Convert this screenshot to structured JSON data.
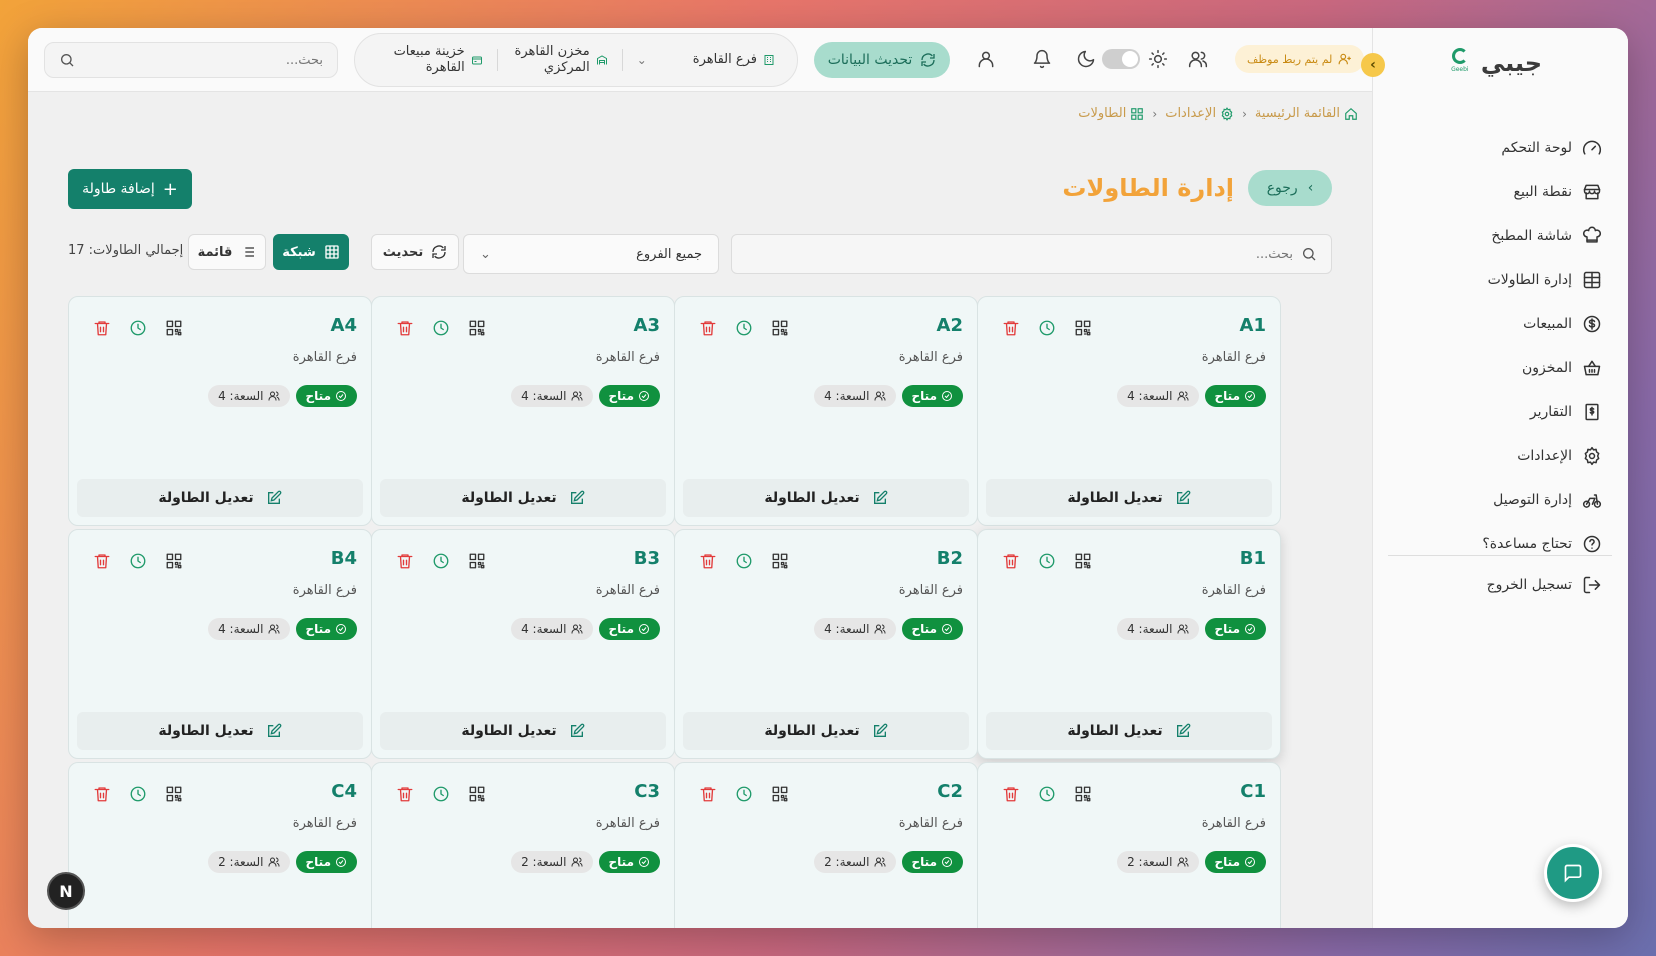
{
  "app": {
    "name": "جيبي",
    "logo_text": "Geebi"
  },
  "sidebar": {
    "items": [
      {
        "label": "لوحة التحكم",
        "icon": "gauge-icon"
      },
      {
        "label": "نقطة البيع",
        "icon": "store-icon"
      },
      {
        "label": "شاشة المطبخ",
        "icon": "chef-hat-icon"
      },
      {
        "label": "إدارة الطاولات",
        "icon": "table-grid-icon"
      },
      {
        "label": "المبيعات",
        "icon": "dollar-circle-icon"
      },
      {
        "label": "المخزون",
        "icon": "basket-icon"
      },
      {
        "label": "التقارير",
        "icon": "receipt-icon"
      },
      {
        "label": "الإعدادات",
        "icon": "gear-icon"
      },
      {
        "label": "إدارة التوصيل",
        "icon": "bike-icon"
      },
      {
        "label": "تحتاج مساعدة؟",
        "icon": "help-circle-icon"
      }
    ],
    "logout": "تسجيل الخروج"
  },
  "header": {
    "employee_badge": "لم يتم ربط موظف",
    "refresh_data": "تحديث البيانات",
    "branch": "فرع القاهرة",
    "warehouse": "مخزن القاهرة المركزي",
    "cashbox": "خزينة مبيعات القاهرة",
    "search_placeholder": "بحث..."
  },
  "breadcrumb": [
    "القائمة الرئيسية",
    "الإعدادات",
    "الطاولات"
  ],
  "page": {
    "title": "إدارة الطاولات",
    "back": "رجوع",
    "add_table": "إضافة طاولة",
    "search_placeholder": "بحث...",
    "branch_filter": "جميع الفروع",
    "refresh": "تحديث",
    "grid_view": "شبكة",
    "list_view": "قائمة",
    "total": "إجمالي الطاولات: 17"
  },
  "tables": [
    {
      "name": "A1",
      "branch": "فرع القاهرة",
      "status": "متاح",
      "capacity": "السعة: 4",
      "edit": "تعديل الطاولة"
    },
    {
      "name": "A2",
      "branch": "فرع القاهرة",
      "status": "متاح",
      "capacity": "السعة: 4",
      "edit": "تعديل الطاولة"
    },
    {
      "name": "A3",
      "branch": "فرع القاهرة",
      "status": "متاح",
      "capacity": "السعة: 4",
      "edit": "تعديل الطاولة"
    },
    {
      "name": "A4",
      "branch": "فرع القاهرة",
      "status": "متاح",
      "capacity": "السعة: 4",
      "edit": "تعديل الطاولة"
    },
    {
      "name": "B1",
      "branch": "فرع القاهرة",
      "status": "متاح",
      "capacity": "السعة: 4",
      "edit": "تعديل الطاولة"
    },
    {
      "name": "B2",
      "branch": "فرع القاهرة",
      "status": "متاح",
      "capacity": "السعة: 4",
      "edit": "تعديل الطاولة"
    },
    {
      "name": "B3",
      "branch": "فرع القاهرة",
      "status": "متاح",
      "capacity": "السعة: 4",
      "edit": "تعديل الطاولة"
    },
    {
      "name": "B4",
      "branch": "فرع القاهرة",
      "status": "متاح",
      "capacity": "السعة: 4",
      "edit": "تعديل الطاولة"
    },
    {
      "name": "C1",
      "branch": "فرع القاهرة",
      "status": "متاح",
      "capacity": "السعة: 2",
      "edit": "تعديل الطاولة"
    },
    {
      "name": "C2",
      "branch": "فرع القاهرة",
      "status": "متاح",
      "capacity": "السعة: 2",
      "edit": "تعديل الطاولة"
    },
    {
      "name": "C3",
      "branch": "فرع القاهرة",
      "status": "متاح",
      "capacity": "السعة: 2",
      "edit": "تعديل الطاولة"
    },
    {
      "name": "C4",
      "branch": "فرع القاهرة",
      "status": "متاح",
      "capacity": "السعة: 2",
      "edit": "تعديل الطاولة"
    }
  ],
  "fab": {
    "n_label": "N"
  },
  "colors": {
    "primary": "#14806b",
    "accent": "#f2a33a",
    "available": "#10913f",
    "danger": "#e23b3b"
  }
}
